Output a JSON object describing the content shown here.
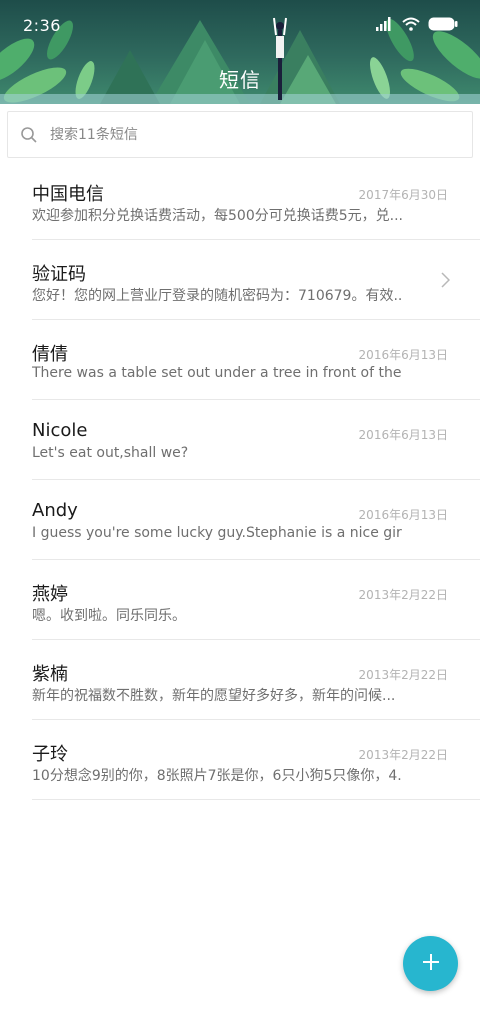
{
  "status_bar": {
    "time": "2:36"
  },
  "header": {
    "title": "短信"
  },
  "search": {
    "placeholder": "搜索11条短信"
  },
  "conversations": [
    {
      "name": "中国电信",
      "date": "2017年6月30日",
      "preview": "欢迎参加积分兑换话费活动，每500分可兑换话费5元，兑..."
    },
    {
      "name": "验证码",
      "date": "",
      "preview": "您好！您的网上营业厅登录的随机密码为：710679。有效..."
    },
    {
      "name": "倩倩",
      "date": "2016年6月13日",
      "preview": "There was a table set out under a tree in front of the h..."
    },
    {
      "name": "Nicole",
      "date": "2016年6月13日",
      "preview": "Let's eat out,shall we?"
    },
    {
      "name": "Andy",
      "date": "2016年6月13日",
      "preview": "I guess you're some lucky guy.Stephanie is a nice girl."
    },
    {
      "name": "燕婷",
      "date": "2013年2月22日",
      "preview": "嗯。收到啦。同乐同乐。"
    },
    {
      "name": "紫楠",
      "date": "2013年2月22日",
      "preview": "新年的祝福数不胜数，新年的愿望好多好多，新年的问候..."
    },
    {
      "name": "子玲",
      "date": "2013年2月22日",
      "preview": "10分想念9别的你，8张照片7张是你，6只小狗5只像你，4..."
    }
  ],
  "icons": {
    "search": "search-icon",
    "chevron": "chevron-right-icon",
    "compose": "plus-icon",
    "signal": "signal-icon",
    "wifi": "wifi-icon",
    "battery": "battery-icon"
  },
  "colors": {
    "fab": "#27b6cf",
    "header": "#2f6a5e"
  }
}
